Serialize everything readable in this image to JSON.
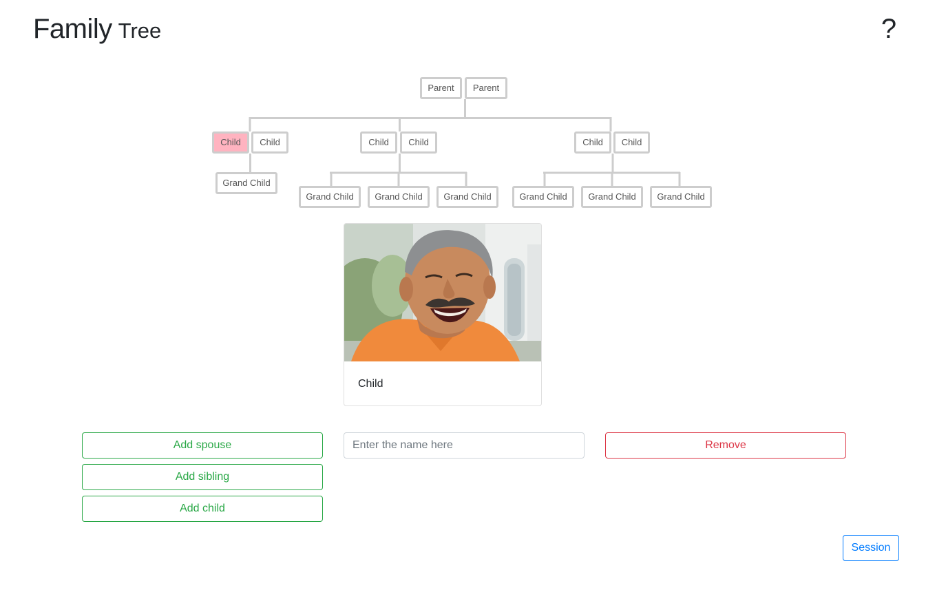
{
  "header": {
    "title_main": "Family",
    "title_sub": "Tree",
    "help_label": "?"
  },
  "tree": {
    "parents": [
      "Parent",
      "Parent"
    ],
    "families": [
      {
        "couple": [
          "Child",
          "Child"
        ],
        "selected_index": 0,
        "children": [
          "Grand Child"
        ]
      },
      {
        "couple": [
          "Child",
          "Child"
        ],
        "children": [
          "Grand Child",
          "Grand Child",
          "Grand Child"
        ]
      },
      {
        "couple": [
          "Child",
          "Child"
        ],
        "children": [
          "Grand Child",
          "Grand Child",
          "Grand Child"
        ]
      }
    ],
    "selected_color": "#ffb3c0"
  },
  "card": {
    "name": "Child"
  },
  "controls": {
    "add_spouse_label": "Add spouse",
    "add_sibling_label": "Add sibling",
    "add_child_label": "Add child",
    "name_placeholder": "Enter the name here",
    "remove_label": "Remove",
    "session_label": "Session"
  },
  "colors": {
    "success": "#28a745",
    "danger": "#dc3545",
    "primary": "#007bff"
  }
}
